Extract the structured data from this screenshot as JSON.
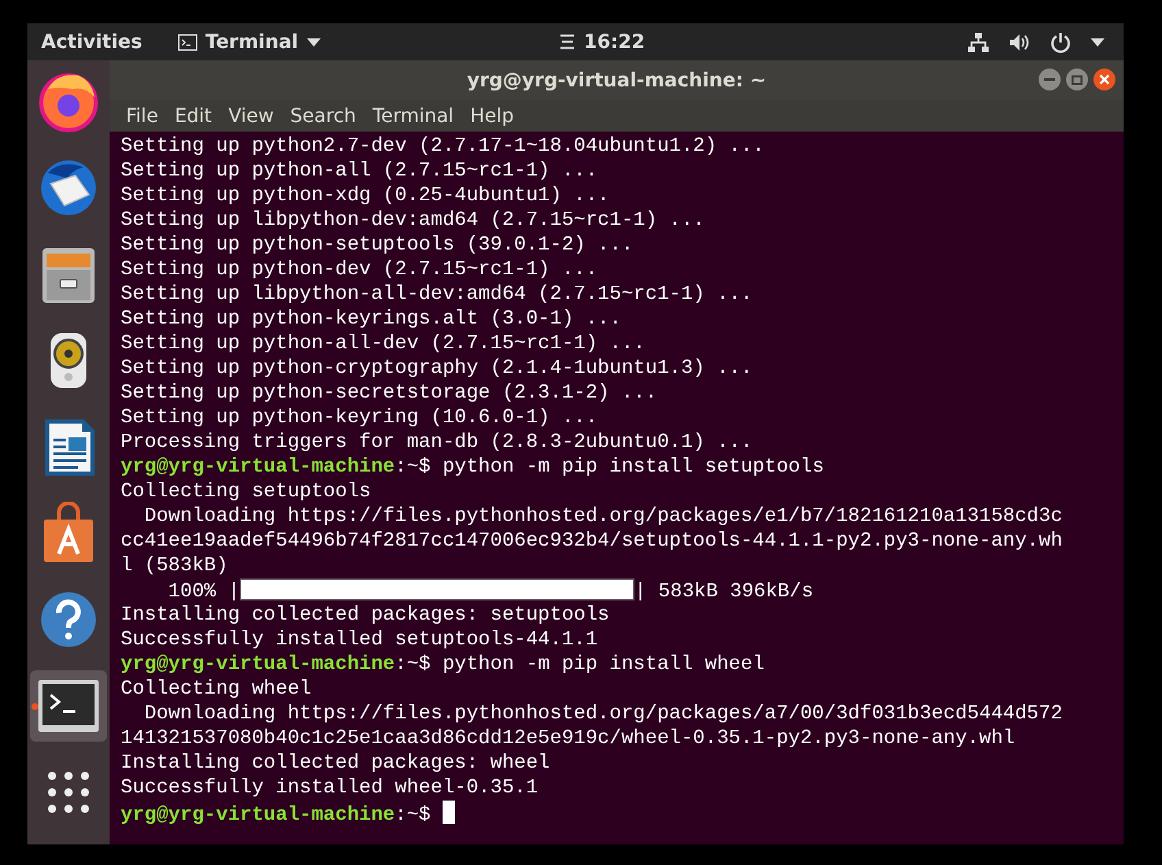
{
  "top_bar": {
    "activities": "Activities",
    "app_menu": "Terminal",
    "clock": "16:22"
  },
  "dock": [
    {
      "kind": "browser",
      "selected": false
    },
    {
      "kind": "mail",
      "selected": false
    },
    {
      "kind": "files",
      "selected": false
    },
    {
      "kind": "music",
      "selected": false
    },
    {
      "kind": "writer",
      "selected": false
    },
    {
      "kind": "store",
      "selected": false
    },
    {
      "kind": "help",
      "selected": false
    },
    {
      "kind": "terminal",
      "selected": true
    },
    {
      "kind": "apps",
      "selected": false
    }
  ],
  "window": {
    "title": "yrg@yrg-virtual-machine: ~",
    "menu": [
      "File",
      "Edit",
      "View",
      "Search",
      "Terminal",
      "Help"
    ]
  },
  "terminal_lines": [
    {
      "kind": "output",
      "text": "Setting up python2.7-dev (2.7.17-1~18.04ubuntu1.2) ..."
    },
    {
      "kind": "output",
      "text": "Setting up python-all (2.7.15~rc1-1) ..."
    },
    {
      "kind": "output",
      "text": "Setting up python-xdg (0.25-4ubuntu1) ..."
    },
    {
      "kind": "output",
      "text": "Setting up libpython-dev:amd64 (2.7.15~rc1-1) ..."
    },
    {
      "kind": "output",
      "text": "Setting up python-setuptools (39.0.1-2) ..."
    },
    {
      "kind": "output",
      "text": "Setting up python-dev (2.7.15~rc1-1) ..."
    },
    {
      "kind": "output",
      "text": "Setting up libpython-all-dev:amd64 (2.7.15~rc1-1) ..."
    },
    {
      "kind": "output",
      "text": "Setting up python-keyrings.alt (3.0-1) ..."
    },
    {
      "kind": "output",
      "text": "Setting up python-all-dev (2.7.15~rc1-1) ..."
    },
    {
      "kind": "output",
      "text": "Setting up python-cryptography (2.1.4-1ubuntu1.3) ..."
    },
    {
      "kind": "output",
      "text": "Setting up python-secretstorage (2.3.1-2) ..."
    },
    {
      "kind": "output",
      "text": "Setting up python-keyring (10.6.0-1) ..."
    },
    {
      "kind": "output",
      "text": "Processing triggers for man-db (2.8.3-2ubuntu0.1) ..."
    },
    {
      "kind": "prompt",
      "user": "yrg@yrg-virtual-machine",
      "path": ":~$",
      "command": "python -m pip install setuptools"
    },
    {
      "kind": "output",
      "text": "Collecting setuptools"
    },
    {
      "kind": "output",
      "text": "  Downloading https://files.pythonhosted.org/packages/e1/b7/182161210a13158cd3c"
    },
    {
      "kind": "output",
      "text": "cc41ee19aadef54496b74f2817cc147006ec932b4/setuptools-44.1.1-py2.py3-none-any.wh"
    },
    {
      "kind": "output",
      "text": "l (583kB)"
    },
    {
      "kind": "progress",
      "prefix": "    100% |",
      "level": 1,
      "suffix": "| 583kB 396kB/s"
    },
    {
      "kind": "output",
      "text": "Installing collected packages: setuptools"
    },
    {
      "kind": "output",
      "text": "Successfully installed setuptools-44.1.1"
    },
    {
      "kind": "prompt",
      "user": "yrg@yrg-virtual-machine",
      "path": ":~$",
      "command": "python -m pip install wheel"
    },
    {
      "kind": "output",
      "text": "Collecting wheel"
    },
    {
      "kind": "output",
      "text": "  Downloading https://files.pythonhosted.org/packages/a7/00/3df031b3ecd5444d572"
    },
    {
      "kind": "output",
      "text": "141321537080b40c1c25e1caa3d86cdd12e5e919c/wheel-0.35.1-py2.py3-none-any.whl"
    },
    {
      "kind": "output",
      "text": "Installing collected packages: wheel"
    },
    {
      "kind": "output",
      "text": "Successfully installed wheel-0.35.1"
    },
    {
      "kind": "active_prompt",
      "user": "yrg@yrg-virtual-machine",
      "path": ":~$"
    }
  ]
}
